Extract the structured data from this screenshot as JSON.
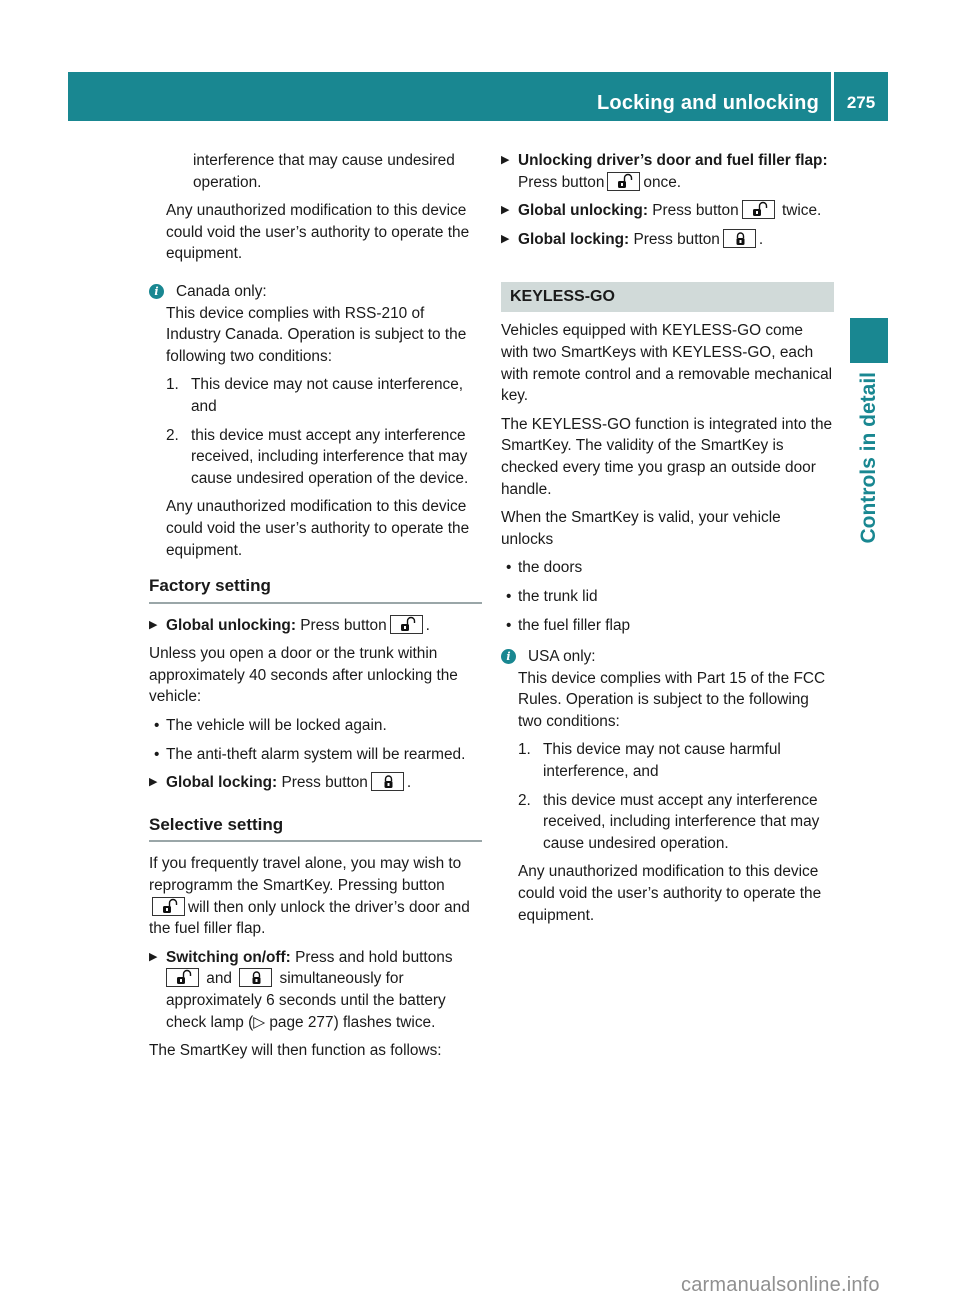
{
  "header": {
    "title": "Locking and unlocking",
    "page_number": "275"
  },
  "side_tab": {
    "label": "Controls in detail"
  },
  "colors": {
    "accent": "#198791",
    "band": "#d1dad9",
    "rule": "#9aa6a8"
  },
  "left": {
    "intro_cont": "interference that may cause undesired operation.",
    "intro_mod": "Any unauthorized modification to this device could void the user’s authority to operate the equipment.",
    "canada": {
      "icon": "info-icon",
      "title": "Canada only:",
      "text": "This device complies with RSS-210 of Industry Canada. Operation is subject to the following two conditions:",
      "conditions": [
        {
          "num": "1.",
          "text": "This device may not cause interference, and"
        },
        {
          "num": "2.",
          "text": "this device must accept any interference received, including interference that may cause undesired operation of the device."
        }
      ],
      "mod": "Any unauthorized modification to this device could void the user’s authority to operate the equipment."
    },
    "factory": {
      "heading": "Factory setting",
      "step1_label": "Global unlocking:",
      "step1_text": "Press button",
      "step1_icon": "unlock-key-icon",
      "para": "Unless you open a door or the trunk within approximately 40 seconds after unlocking the vehicle:",
      "bullets": [
        "The vehicle will be locked again.",
        "The anti-theft alarm system will be rearmed."
      ],
      "step2_label": "Global locking:",
      "step2_text": "Press button",
      "step2_icon": "lock-key-icon"
    },
    "selective": {
      "heading": "Selective setting",
      "para_a": "If you frequently travel alone, you may wish to reprogramm the SmartKey. Pressing button",
      "para_b": "will then only unlock the driver’s door and the fuel filler flap.",
      "step_label": "Switching on/off:",
      "step_text_a": "Press and hold buttons",
      "step_and": "and",
      "step_text_b": "simultaneously for approximately 6 seconds until the battery check lamp (",
      "step_ref": "▷ page 277",
      "step_text_c": ") flashes twice.",
      "after": "The SmartKey will then function as follows:"
    }
  },
  "right": {
    "steps": [
      {
        "label": "Unlocking driver’s door and fuel filler flap:",
        "text_a": "Press button",
        "icon": "unlock",
        "text_b": "once."
      },
      {
        "label": "Global unlocking:",
        "text_a": "Press button",
        "icon": "unlock",
        "text_b": "twice."
      },
      {
        "label": "Global locking:",
        "text_a": "Press button",
        "icon": "lock",
        "text_b": "."
      }
    ],
    "keyless": {
      "heading": "KEYLESS-GO",
      "p1": "Vehicles equipped with KEYLESS-GO come with two SmartKeys with KEYLESS-GO, each with remote control and a removable mechanical key.",
      "p2": "The KEYLESS-GO function is integrated into the SmartKey. The validity of the SmartKey is checked every time you grasp an outside door handle.",
      "p3": "When the SmartKey is valid, your vehicle unlocks",
      "bullets": [
        "the doors",
        "the trunk lid",
        "the fuel filler flap"
      ]
    },
    "usa": {
      "icon": "info-icon",
      "title": "USA only:",
      "text": "This device complies with Part 15 of the FCC Rules. Operation is subject to the following two conditions:",
      "conditions": [
        {
          "num": "1.",
          "text": "This device may not cause harmful interference, and"
        },
        {
          "num": "2.",
          "text": "this device must accept any interference received, including interference that may cause undesired operation."
        }
      ],
      "mod": "Any unauthorized modification to this device could void the user’s authority to operate the equipment."
    }
  },
  "watermark": "carmanualsonline.info"
}
